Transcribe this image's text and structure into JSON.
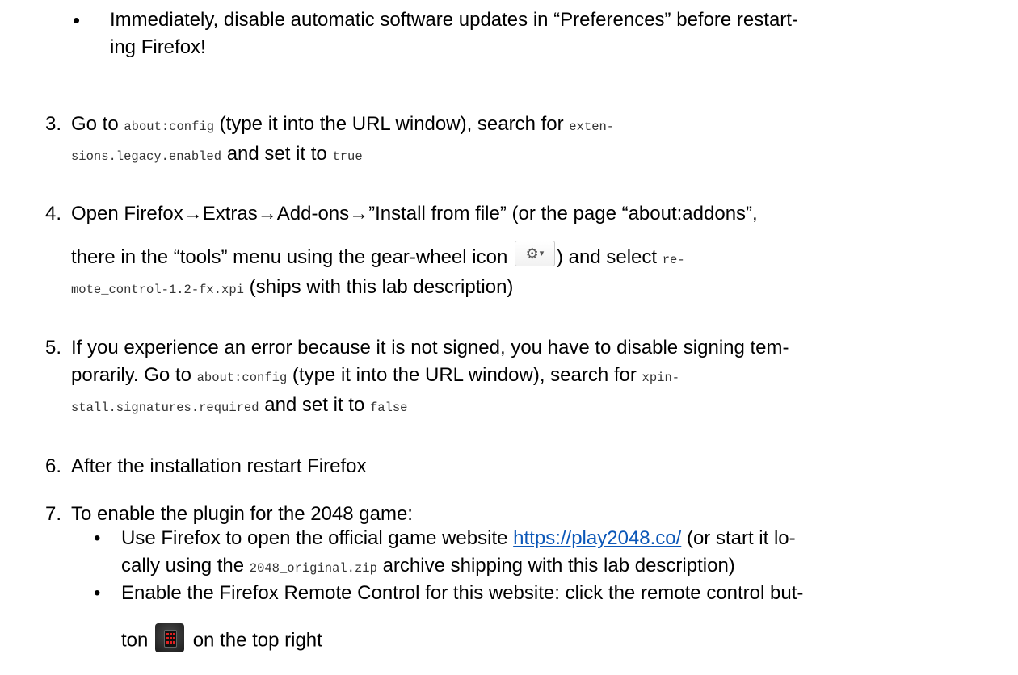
{
  "bullet_top": {
    "symbol": "•",
    "line1": "Immediately, disable automatic software updates in “Preferences” before restart-",
    "line2": "ing Firefox!"
  },
  "steps": [
    {
      "num": "3.",
      "p1": "Go to ",
      "c1": "about:config",
      "p2": " (type it into the URL window), search for ",
      "c2": "exten-",
      "c3": "sions.legacy.enabled",
      "p3": " and set it to ",
      "c4": "true"
    },
    {
      "num": "4.",
      "line1": "Open Firefox→Extras→Add-ons→”Install from file” (or the page “about:addons”,",
      "p1": "there in the “tools” menu using the gear-wheel icon ",
      "p2": ") and select ",
      "c1": "re-",
      "c2": "mote_control-1.2-fx.xpi",
      "p3": " (ships with this lab description)"
    },
    {
      "num": "5.",
      "line1": "If you experience an error because it is not signed, you have to disable signing tem-",
      "p1": "porarily. Go to ",
      "c1": "about:config",
      "p2": " (type it into the URL window), search for ",
      "c2": "xpin-",
      "c3": "stall.signatures.required",
      "p3": " and set it to ",
      "c4": "false"
    },
    {
      "num": "6.",
      "line1": "After the installation restart Firefox"
    },
    {
      "num": "7.",
      "line1": "To enable the plugin for the 2048 game:",
      "subs": [
        {
          "symbol": "•",
          "p1": "Use Firefox to open the official game website ",
          "link": "https://play2048.co/",
          "p2": " (or start it lo-",
          "p3": "cally using the ",
          "c1": "2048_original.zip",
          "p4": " archive shipping with this lab description)"
        },
        {
          "symbol": "•",
          "p1": "Enable the Firefox Remote Control for this website: click the remote control but-",
          "p2": "ton ",
          "p3": " on the top right"
        }
      ]
    }
  ],
  "icons": {
    "gear": "gear-wheel-icon",
    "remote": "remote-control-icon"
  }
}
